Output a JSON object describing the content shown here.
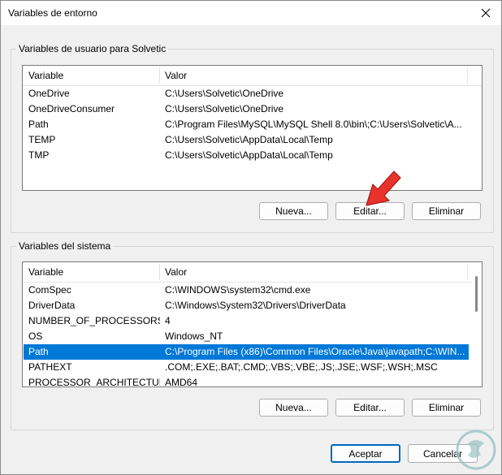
{
  "window": {
    "title": "Variables de entorno"
  },
  "user_vars": {
    "legend": "Variables de usuario para Solvetic",
    "columns": [
      "Variable",
      "Valor"
    ],
    "rows": [
      {
        "name": "OneDrive",
        "value": "C:\\Users\\Solvetic\\OneDrive"
      },
      {
        "name": "OneDriveConsumer",
        "value": "C:\\Users\\Solvetic\\OneDrive"
      },
      {
        "name": "Path",
        "value": "C:\\Program Files\\MySQL\\MySQL Shell 8.0\\bin\\;C:\\Users\\Solvetic\\A..."
      },
      {
        "name": "TEMP",
        "value": "C:\\Users\\Solvetic\\AppData\\Local\\Temp"
      },
      {
        "name": "TMP",
        "value": "C:\\Users\\Solvetic\\AppData\\Local\\Temp"
      }
    ],
    "buttons": {
      "new": "Nueva...",
      "edit": "Editar...",
      "delete": "Eliminar"
    }
  },
  "system_vars": {
    "legend": "Variables del sistema",
    "columns": [
      "Variable",
      "Valor"
    ],
    "rows": [
      {
        "name": "ComSpec",
        "value": "C:\\WINDOWS\\system32\\cmd.exe"
      },
      {
        "name": "DriverData",
        "value": "C:\\Windows\\System32\\Drivers\\DriverData"
      },
      {
        "name": "NUMBER_OF_PROCESSORS",
        "value": "4"
      },
      {
        "name": "OS",
        "value": "Windows_NT"
      },
      {
        "name": "Path",
        "value": "C:\\Program Files (x86)\\Common Files\\Oracle\\Java\\javapath;C:\\WIN..."
      },
      {
        "name": "PATHEXT",
        "value": ".COM;.EXE;.BAT;.CMD;.VBS;.VBE;.JS;.JSE;.WSF;.WSH;.MSC"
      },
      {
        "name": "PROCESSOR_ARCHITECTURE",
        "value": "AMD64"
      }
    ],
    "selected_row": 4,
    "buttons": {
      "new": "Nueva...",
      "edit": "Editar...",
      "delete": "Eliminar"
    }
  },
  "footer": {
    "accept": "Aceptar",
    "cancel": "Cancelar"
  },
  "colors": {
    "selection": "#0078d7",
    "default_button_border": "#0067c0",
    "arrow": "#e8322b"
  },
  "icons": {
    "close": "close-icon",
    "arrow": "red-arrow-icon",
    "watermark": "solvetic-logo-icon"
  }
}
